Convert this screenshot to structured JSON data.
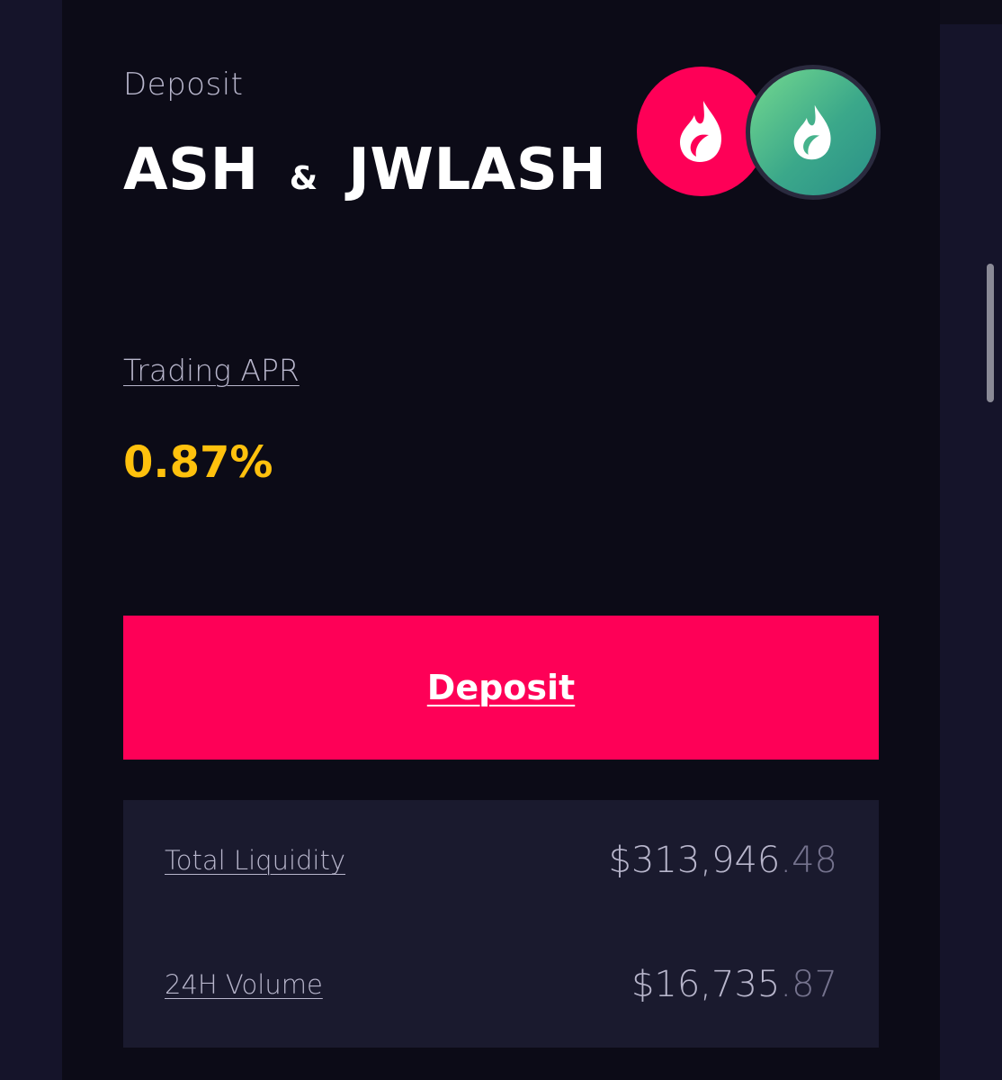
{
  "header": {
    "eyebrow": "Deposit",
    "token_a": "ASH",
    "separator": "&",
    "token_b": "JWLASH"
  },
  "logos": {
    "token_a_icon": "ash-flame-icon",
    "token_b_icon": "jwlash-flame-icon",
    "token_a_color": "#fe0057",
    "token_b_color": "#4fbf8d"
  },
  "apr": {
    "label": "Trading APR",
    "value": "0.87%",
    "color": "#ffc10d"
  },
  "deposit_button": {
    "label": "Deposit",
    "color": "#fe0057"
  },
  "stats": {
    "total_liquidity": {
      "label": "Total Liquidity",
      "whole": "$313,946",
      "decimal": ".48"
    },
    "volume_24h": {
      "label": "24H Volume",
      "whole": "$16,735",
      "decimal": ".87"
    }
  }
}
